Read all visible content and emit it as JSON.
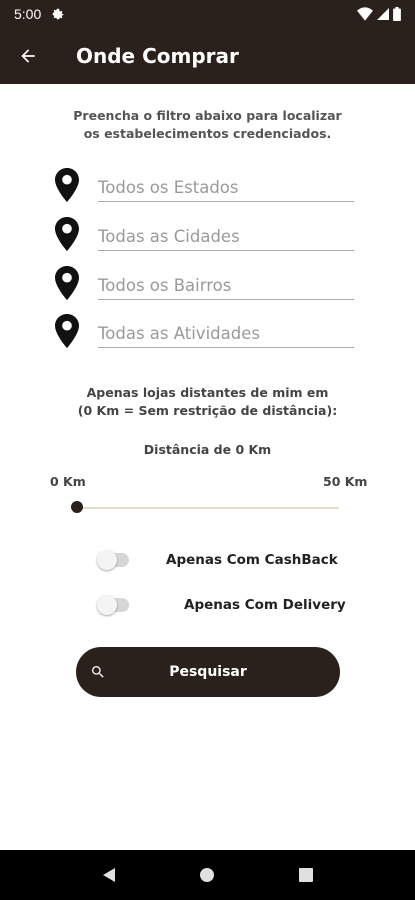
{
  "status_bar": {
    "time": "5:00",
    "icons": [
      "gear-icon",
      "wifi-icon",
      "signal-icon",
      "battery-icon"
    ]
  },
  "app_bar": {
    "title": "Onde Comprar",
    "back_icon": "arrow-left-icon"
  },
  "intro": {
    "line1": "Preencha o filtro abaixo para localizar",
    "line2": "os estabelecimentos credenciados."
  },
  "filters": [
    {
      "placeholder": "Todos os Estados",
      "icon": "location-pin-icon"
    },
    {
      "placeholder": "Todas as Cidades",
      "icon": "location-pin-icon"
    },
    {
      "placeholder": "Todos os Bairros",
      "icon": "location-pin-icon"
    },
    {
      "placeholder": "Todas as Atividades",
      "icon": "location-pin-icon"
    }
  ],
  "distance": {
    "line1": "Apenas lojas distantes de mim em",
    "line2": "(0 Km = Sem restrição de distância):",
    "value_label": "Distância de 0 Km",
    "min_label": "0 Km",
    "max_label": "50 Km",
    "value": 0
  },
  "toggles": [
    {
      "label": "Apenas Com CashBack",
      "on": false
    },
    {
      "label": "Apenas Com Delivery",
      "on": false
    }
  ],
  "search_button": {
    "label": "Pesquisar",
    "icon": "search-icon"
  },
  "colors": {
    "primary": "#2b211c",
    "slider_track": "#e3dcc8",
    "placeholder": "#9a9a9a"
  }
}
